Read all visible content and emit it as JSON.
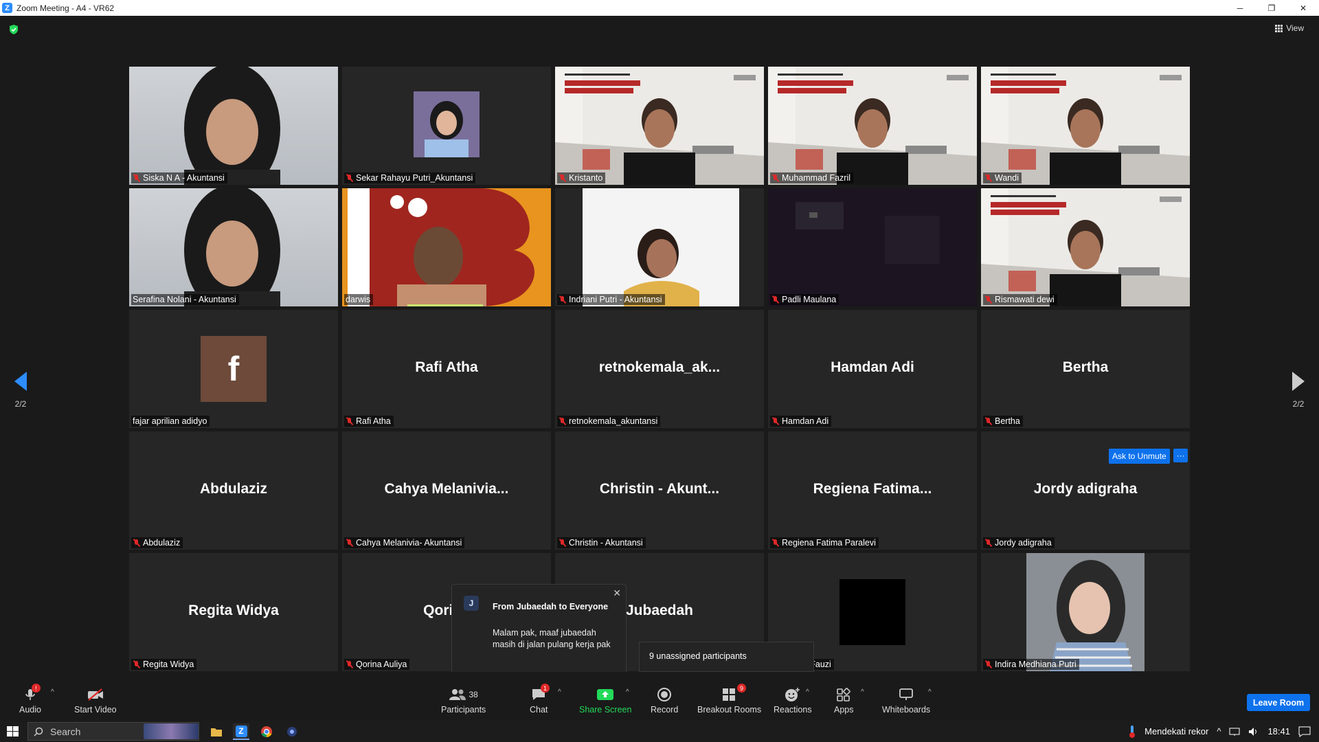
{
  "window": {
    "title": "Zoom Meeting - A4 - VR62",
    "minimize": "─",
    "restore": "❐",
    "close": "✕"
  },
  "view_button": "View",
  "pagination": {
    "left": "2/2",
    "right": "2/2"
  },
  "tiles": [
    {
      "id": "siska",
      "label": "Siska N A - Akuntansi",
      "muted": true,
      "video": "light-person"
    },
    {
      "id": "sekar",
      "label": "Sekar Rahayu Putri_Akuntansi",
      "muted": true,
      "video": "small-photo"
    },
    {
      "id": "kristanto",
      "label": "Kristanto",
      "muted": true,
      "video": "classroom"
    },
    {
      "id": "fazril",
      "label": "Muhammad Fazril",
      "muted": true,
      "video": "classroom"
    },
    {
      "id": "wandi",
      "label": "Wandi",
      "muted": true,
      "video": "classroom"
    },
    {
      "id": "serafina",
      "label": "Serafina Nolani - Akuntansi",
      "muted": false,
      "video": "light-person",
      "speaking": true
    },
    {
      "id": "darwis",
      "label": "darwis",
      "muted": false,
      "video": "orange-b"
    },
    {
      "id": "indriani",
      "label": "Indriani Putri - Akuntansi",
      "muted": true,
      "video": "white-person"
    },
    {
      "id": "padli",
      "label": "Padli Maulana",
      "muted": true,
      "video": "dark"
    },
    {
      "id": "rismawati",
      "label": "Rismawati dewi",
      "muted": true,
      "video": "classroom"
    },
    {
      "id": "fajar",
      "label": "fajar aprilian adidyo",
      "muted": false,
      "avatar": "f"
    },
    {
      "id": "rafi",
      "label": "Rafi Atha",
      "muted": true,
      "bigname": "Rafi Atha"
    },
    {
      "id": "retno",
      "label": "retnokemala_akuntansi",
      "muted": true,
      "bigname": "retnokemala_ak..."
    },
    {
      "id": "hamdan",
      "label": "Hamdan Adi",
      "muted": true,
      "bigname": "Hamdan Adi"
    },
    {
      "id": "bertha",
      "label": "Bertha",
      "muted": true,
      "bigname": "Bertha"
    },
    {
      "id": "abdulaziz",
      "label": "Abdulaziz",
      "muted": true,
      "bigname": "Abdulaziz"
    },
    {
      "id": "cahya",
      "label": "Cahya Melanivia- Akuntansi",
      "muted": true,
      "bigname": "Cahya  Melanivia..."
    },
    {
      "id": "christin",
      "label": "Christin  - Akuntansi",
      "muted": true,
      "bigname": "Christin  - Akunt..."
    },
    {
      "id": "regiena",
      "label": "Regiena Fatima Paralevi",
      "muted": true,
      "bigname": "Regiena  Fatima..."
    },
    {
      "id": "jordy",
      "label": "Jordy adigraha",
      "muted": true,
      "bigname": "Jordy adigraha"
    },
    {
      "id": "regita",
      "label": "Regita Widya",
      "muted": true,
      "bigname": "Regita Widya"
    },
    {
      "id": "qorina",
      "label": "Qorina Auliya",
      "muted": true,
      "bigname": "Qorina"
    },
    {
      "id": "jubaedah",
      "label": "",
      "muted": false,
      "bigname": "Jubaedah"
    },
    {
      "id": "rifqi",
      "label": "mad Rifqi Fauzi",
      "muted": false,
      "video": "black-square"
    },
    {
      "id": "indira",
      "label": "Indira Medhiana Putri",
      "muted": true,
      "video": "selfie"
    }
  ],
  "ask_to_unmute": "Ask to Unmute",
  "more_button": "···",
  "chat_popup": {
    "avatar": "J",
    "from": "From Jubaedah to Everyone",
    "message": "Malam pak, maaf jubaedah masih di jalan pulang kerja pak",
    "close": "✕"
  },
  "unassigned": "9 unassigned participants",
  "toolbar": {
    "audio": "Audio",
    "start_video": "Start Video",
    "participants": "Participants",
    "participants_count": "38",
    "chat": "Chat",
    "chat_badge": "1",
    "share_screen": "Share Screen",
    "record": "Record",
    "breakout_rooms": "Breakout Rooms",
    "breakout_badge": "9",
    "reactions": "Reactions",
    "apps": "Apps",
    "whiteboards": "Whiteboards",
    "leave_room": "Leave Room",
    "audio_badge": "!"
  },
  "taskbar": {
    "search": "Search",
    "weather": "Mendekati rekor",
    "time": "18:41"
  },
  "colors": {
    "accent": "#2D8CFF",
    "leave": "#0e72ed",
    "muted": "#e02828",
    "speaking": "#c9e86f",
    "share": "#23d959"
  }
}
